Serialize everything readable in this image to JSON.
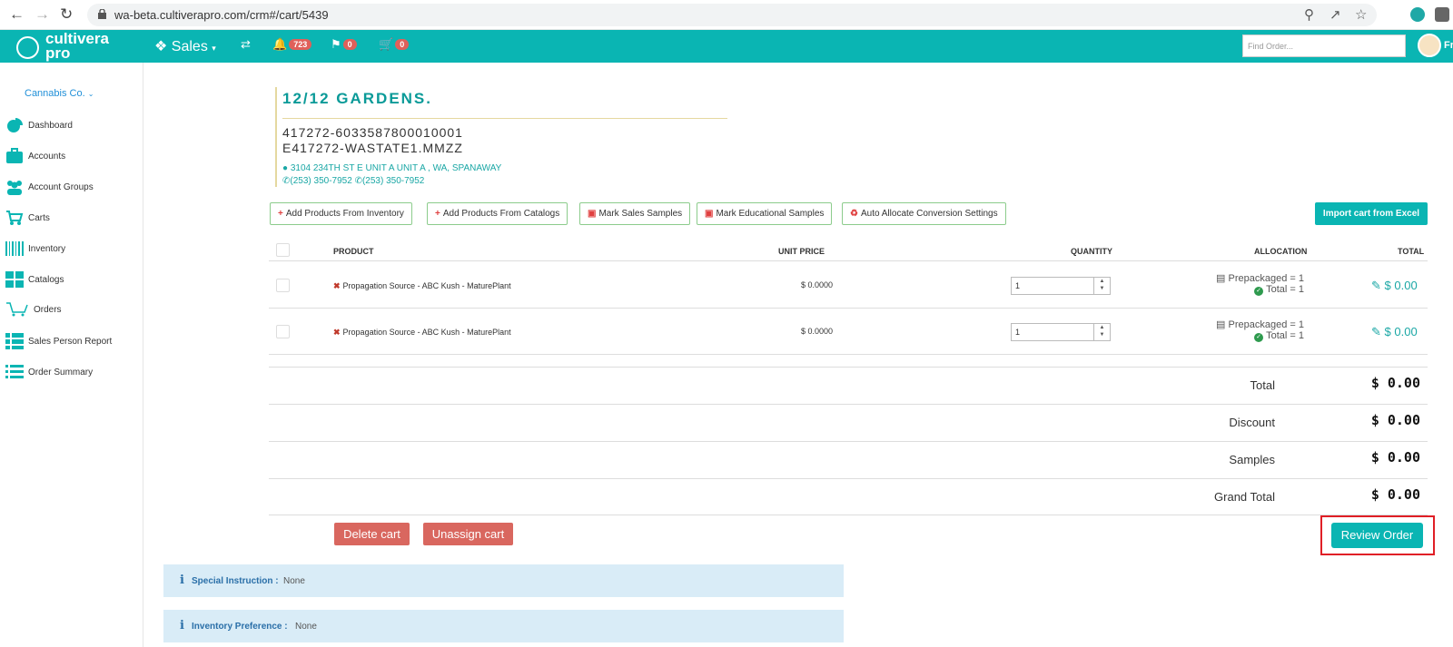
{
  "browser": {
    "url": "wa-beta.cultiverapro.com/crm#/cart/5439"
  },
  "topbar": {
    "logo_line1": "cultivera",
    "logo_line2": "pro",
    "sales_label": "Sales",
    "notifications_count": "723",
    "flags_count": "0",
    "cart_count": "0",
    "find_placeholder": "Find Order...",
    "user_name": "Fr"
  },
  "sidebar": {
    "company": "Cannabis Co.",
    "items": [
      {
        "label": "Dashboard",
        "icon": "pie-chart-icon"
      },
      {
        "label": "Accounts",
        "icon": "briefcase-icon"
      },
      {
        "label": "Account Groups",
        "icon": "users-icon"
      },
      {
        "label": "Carts",
        "icon": "cart-icon"
      },
      {
        "label": "Inventory",
        "icon": "barcode-icon"
      },
      {
        "label": "Catalogs",
        "icon": "grid-icon"
      },
      {
        "label": "Orders",
        "icon": "cart-outline-icon"
      },
      {
        "label": "Sales Person Report",
        "icon": "list-icon"
      },
      {
        "label": "Order Summary",
        "icon": "list-alt-icon"
      }
    ]
  },
  "account": {
    "name": "12/12 GARDENS.",
    "license_id": "417272-6033587800010001",
    "code": "E417272-WASTATE1.MMZZ",
    "address": "3104 234TH ST E UNIT A UNIT A , WA, SPANAWAY",
    "phone1": "(253) 350-7952",
    "phone2": "(253) 350-7952"
  },
  "actions": {
    "add_inventory": "Add Products From Inventory",
    "add_catalogs": "Add Products From Catalogs",
    "mark_sales_samples": "Mark Sales Samples",
    "mark_edu_samples": "Mark Educational Samples",
    "auto_allocate": "Auto Allocate Conversion Settings",
    "import_excel": "Import cart from Excel"
  },
  "table": {
    "headers": {
      "product": "PRODUCT",
      "unit_price": "UNIT PRICE",
      "quantity": "QUANTITY",
      "allocation": "ALLOCATION",
      "total": "TOTAL"
    },
    "rows": [
      {
        "product": "Propagation Source - ABC Kush - MaturePlant",
        "unit_price": "$ 0.0000",
        "quantity": "1",
        "alloc_prepackaged": "Prepackaged = 1",
        "alloc_total": "Total = 1",
        "total": "$ 0.00"
      },
      {
        "product": "Propagation Source - ABC Kush - MaturePlant",
        "unit_price": "$ 0.0000",
        "quantity": "1",
        "alloc_prepackaged": "Prepackaged = 1",
        "alloc_total": "Total = 1",
        "total": "$ 0.00"
      }
    ]
  },
  "summary": {
    "total_label": "Total",
    "total_value": "$ 0.00",
    "discount_label": "Discount",
    "discount_value": "$ 0.00",
    "samples_label": "Samples",
    "samples_value": "$ 0.00",
    "grand_label": "Grand Total",
    "grand_value": "$ 0.00"
  },
  "buttons": {
    "delete_cart": "Delete cart",
    "unassign_cart": "Unassign cart",
    "review_order": "Review Order"
  },
  "info": {
    "special_label": "Special Instruction :",
    "special_value": "None",
    "inventory_label": "Inventory Preference :",
    "inventory_value": "None"
  },
  "colors": {
    "brand_teal": "#0ab5b3",
    "danger": "#d9675f",
    "highlight": "#e01f26"
  }
}
